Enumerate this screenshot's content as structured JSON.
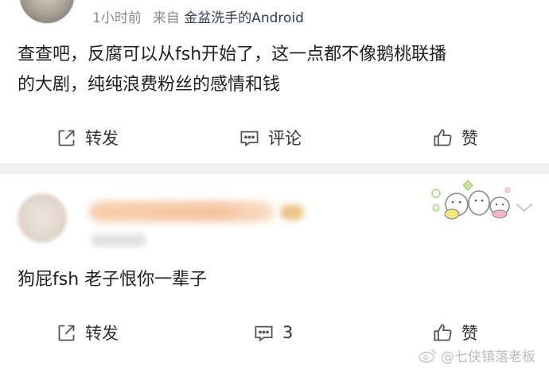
{
  "post": {
    "time": "1小时前",
    "source_prefix": "来自",
    "source_name": "金盆洗手的Android",
    "content_line1": "查查吧，反腐可以从fsh开始了，这一点都不像鹅桃联播",
    "content_line2": "的大剧，纯纯浪费粉丝的感情和钱",
    "actions": {
      "repost": "转发",
      "comment": "评论",
      "like": "赞"
    }
  },
  "comment": {
    "text": "狗屁fsh 老子恨你一辈子",
    "actions": {
      "repost": "转发",
      "comment_count": "3",
      "like": "赞"
    }
  },
  "watermark": {
    "text": "@七侠镇落老板"
  },
  "colors": {
    "source_name": "#333d57",
    "meta_gray": "#8a8a8a",
    "divider": "#f0f0f0"
  }
}
